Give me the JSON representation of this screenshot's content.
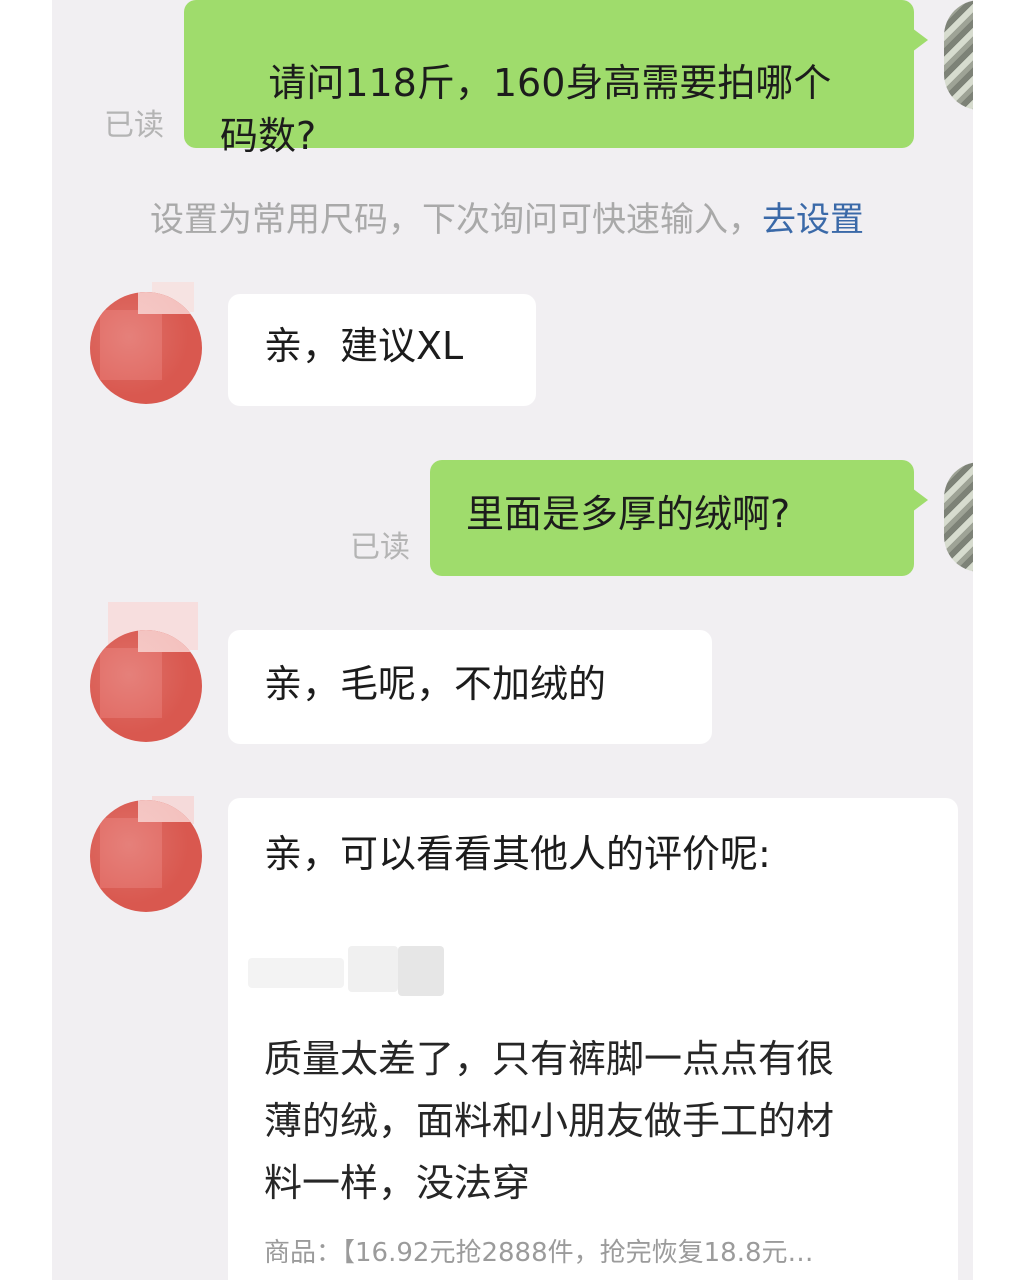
{
  "messages": [
    {
      "text": "请问118斤，160身高需要拍哪个\n码数?",
      "read_label": "已读"
    },
    {
      "text": "亲，建议XL"
    },
    {
      "text": "里面是多厚的绒啊?",
      "read_label": "已读"
    },
    {
      "text": "亲，毛呢，不加绒的"
    },
    {
      "text": "亲，可以看看其他人的评价呢:"
    }
  ],
  "hint": {
    "text": "设置为常用尺码，下次询问可快速输入，",
    "link": "去设置"
  },
  "review": {
    "text": "质量太差了，只有裤脚一点点有很\n薄的绒，面料和小朋友做手工的材\n料一样，没法穿",
    "product_label": "商品：",
    "product_value": "【16.92元抢2888件，抢完恢复18.8元…"
  }
}
